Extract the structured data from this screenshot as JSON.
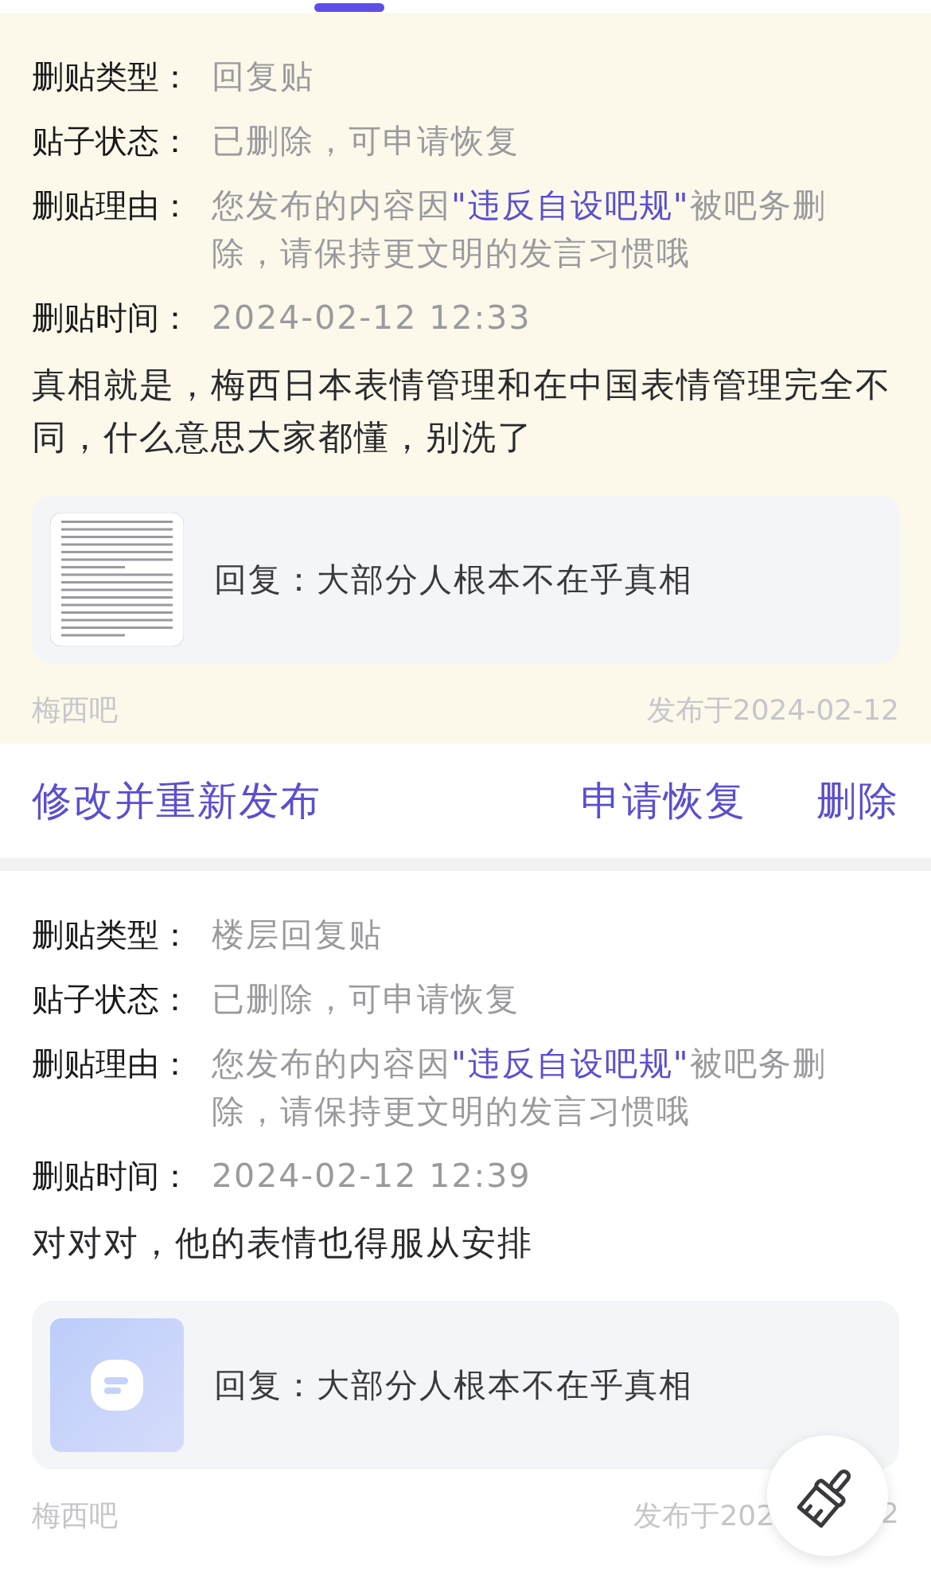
{
  "posts": [
    {
      "highlighted": true,
      "fields": [
        {
          "label": "删贴类型：",
          "parts": [
            {
              "kind": "plain",
              "text": "回复贴"
            }
          ]
        },
        {
          "label": "贴子状态：",
          "parts": [
            {
              "kind": "plain",
              "text": "已删除，可申请恢复"
            }
          ]
        },
        {
          "label": "删贴理由：",
          "parts": [
            {
              "kind": "plain",
              "text": "您发布的内容因"
            },
            {
              "kind": "link",
              "text": "\"违反自设吧规\""
            },
            {
              "kind": "plain",
              "text": "被吧务删除，请保持更文明的发言习惯哦"
            }
          ]
        },
        {
          "label": "删贴时间：",
          "parts": [
            {
              "kind": "plain",
              "text": "2024-02-12 12:33"
            }
          ]
        }
      ],
      "content": "真相就是，梅西日本表情管理和在中国表情管理完全不同，什么意思大家都懂，别洗了",
      "quote": {
        "kind": "picture",
        "text": "回复：大部分人根本不在乎真相"
      },
      "forum": "梅西吧",
      "date_parts": [
        "发布于2024-02-12"
      ],
      "actions": [
        {
          "label": "修改并重新发布",
          "kind": "left"
        },
        {
          "label": "申请恢复",
          "kind": "right"
        },
        {
          "label": "删除",
          "kind": "right"
        }
      ]
    },
    {
      "highlighted": false,
      "fields": [
        {
          "label": "删贴类型：",
          "parts": [
            {
              "kind": "plain",
              "text": "楼层回复贴"
            }
          ]
        },
        {
          "label": "贴子状态：",
          "parts": [
            {
              "kind": "plain",
              "text": "已删除，可申请恢复"
            }
          ]
        },
        {
          "label": "删贴理由：",
          "parts": [
            {
              "kind": "plain",
              "text": "您发布的内容因"
            },
            {
              "kind": "link",
              "text": "\"违反自设吧规\""
            },
            {
              "kind": "plain",
              "text": "被吧务删除，请保持更文明的发言习惯哦"
            }
          ]
        },
        {
          "label": "删贴时间：",
          "parts": [
            {
              "kind": "plain",
              "text": "2024-02-12 12:39"
            }
          ]
        }
      ],
      "content": "对对对，他的表情也得服从安排",
      "quote": {
        "kind": "icon",
        "text": "回复：大部分人根本不在乎真相"
      },
      "forum": "梅西吧",
      "date_parts": [
        "发布于202",
        "2"
      ]
    }
  ]
}
